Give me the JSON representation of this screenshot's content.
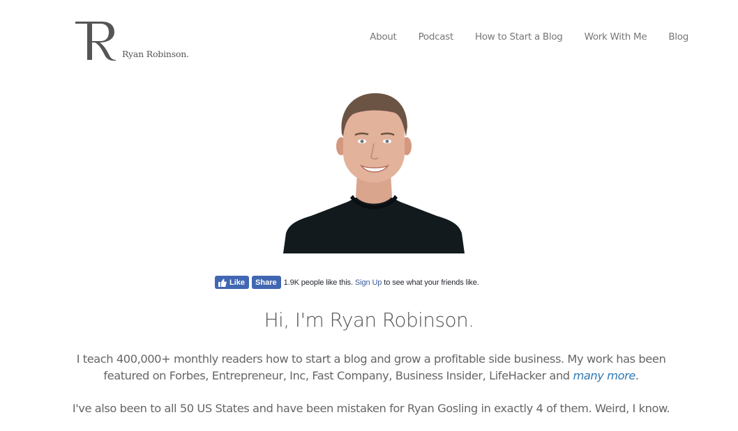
{
  "site": {
    "logo_text": "Ryan Robinson.",
    "logo_icon": "r-monogram-icon"
  },
  "nav": {
    "items": [
      {
        "label": "About"
      },
      {
        "label": "Podcast"
      },
      {
        "label": "How to Start a Blog"
      },
      {
        "label": "Work With Me"
      },
      {
        "label": "Blog"
      }
    ]
  },
  "portrait": {
    "alt": "Portrait photo of Ryan Robinson smiling, wearing a black t-shirt"
  },
  "facebook": {
    "like_label": "Like",
    "share_label": "Share",
    "count_text": "1.9K people like this.",
    "signup_label": "Sign Up",
    "after_signup_text": "to see what your friends like.",
    "brand_color": "#4267b2",
    "link_color": "#365899"
  },
  "hero": {
    "title": "Hi, I'm Ryan Robinson.",
    "paragraph1_lead": "I teach 400,000+ monthly readers how to start a blog and grow a profitable side business. My work has been featured on Forbes, Entrepreneur, Inc, Fast Company, Business Insider, LifeHacker and",
    "paragraph1_link": "many more",
    "paragraph1_tail": ".",
    "paragraph2": "I've also been to all 50 US States and have been mistaken for Ryan Gosling in exactly 4 of them. Weird, I know.",
    "link_color": "#2f79b4"
  }
}
